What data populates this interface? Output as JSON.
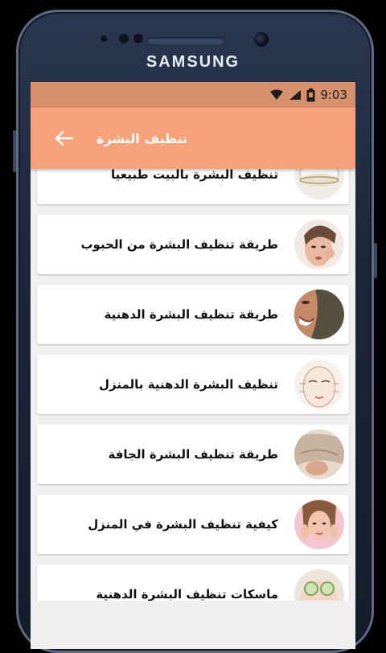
{
  "device": {
    "brand": "SAMSUNG"
  },
  "status_bar": {
    "time": "9:03",
    "icons": [
      "wifi-icon",
      "signal-icon",
      "battery-icon"
    ]
  },
  "app_bar": {
    "title": "تنظيف البشرة",
    "back_icon": "arrow-left-icon"
  },
  "list": {
    "items": [
      {
        "title": "تنظيف البشرة بالبيت طبيعيا",
        "thumbnail": "cream-jar-icon"
      },
      {
        "title": "طريقة تنظيف البشرة من الحبوب",
        "thumbnail": "acne-face-icon"
      },
      {
        "title": "طريقة تنظيف البشرة الدهنية",
        "thumbnail": "smiling-face-icon"
      },
      {
        "title": "تنظيف البشرة الدهنية بالمنزل",
        "thumbnail": "face-mask-icon"
      },
      {
        "title": "طريقة تنظيف البشرة الجافة",
        "thumbnail": "towel-face-icon"
      },
      {
        "title": "كيفية تنظيف البشرة في المنزل",
        "thumbnail": "woman-portrait-icon"
      },
      {
        "title": "ماسكات تنظيف البشرة الدهنية",
        "thumbnail": "cucumber-eyes-icon"
      }
    ]
  },
  "colors": {
    "status_bar": "#d6906c",
    "app_bar": "#f8a27c",
    "background": "#f0f0f0"
  }
}
